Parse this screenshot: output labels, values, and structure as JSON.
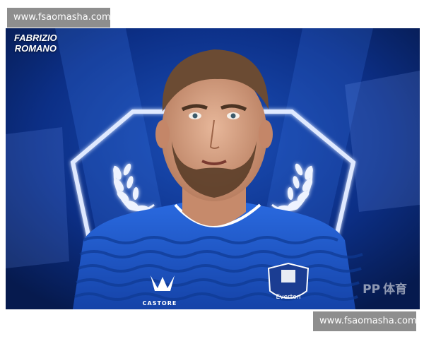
{
  "watermark": {
    "top_text": "www.fsaomasha.com",
    "bottom_text": "www.fsaomasha.com"
  },
  "photo": {
    "credit_line1": "FABRIZIO",
    "credit_line2": "ROMANO",
    "kit_brand": "CASTORE",
    "crest_name": "Everton",
    "corner_logo": "PP",
    "corner_logo_cn": "体育",
    "colors": {
      "kit_blue": "#1f5fd0",
      "background_blue": "#0a2a73",
      "glow": "#dfe9ff"
    }
  }
}
